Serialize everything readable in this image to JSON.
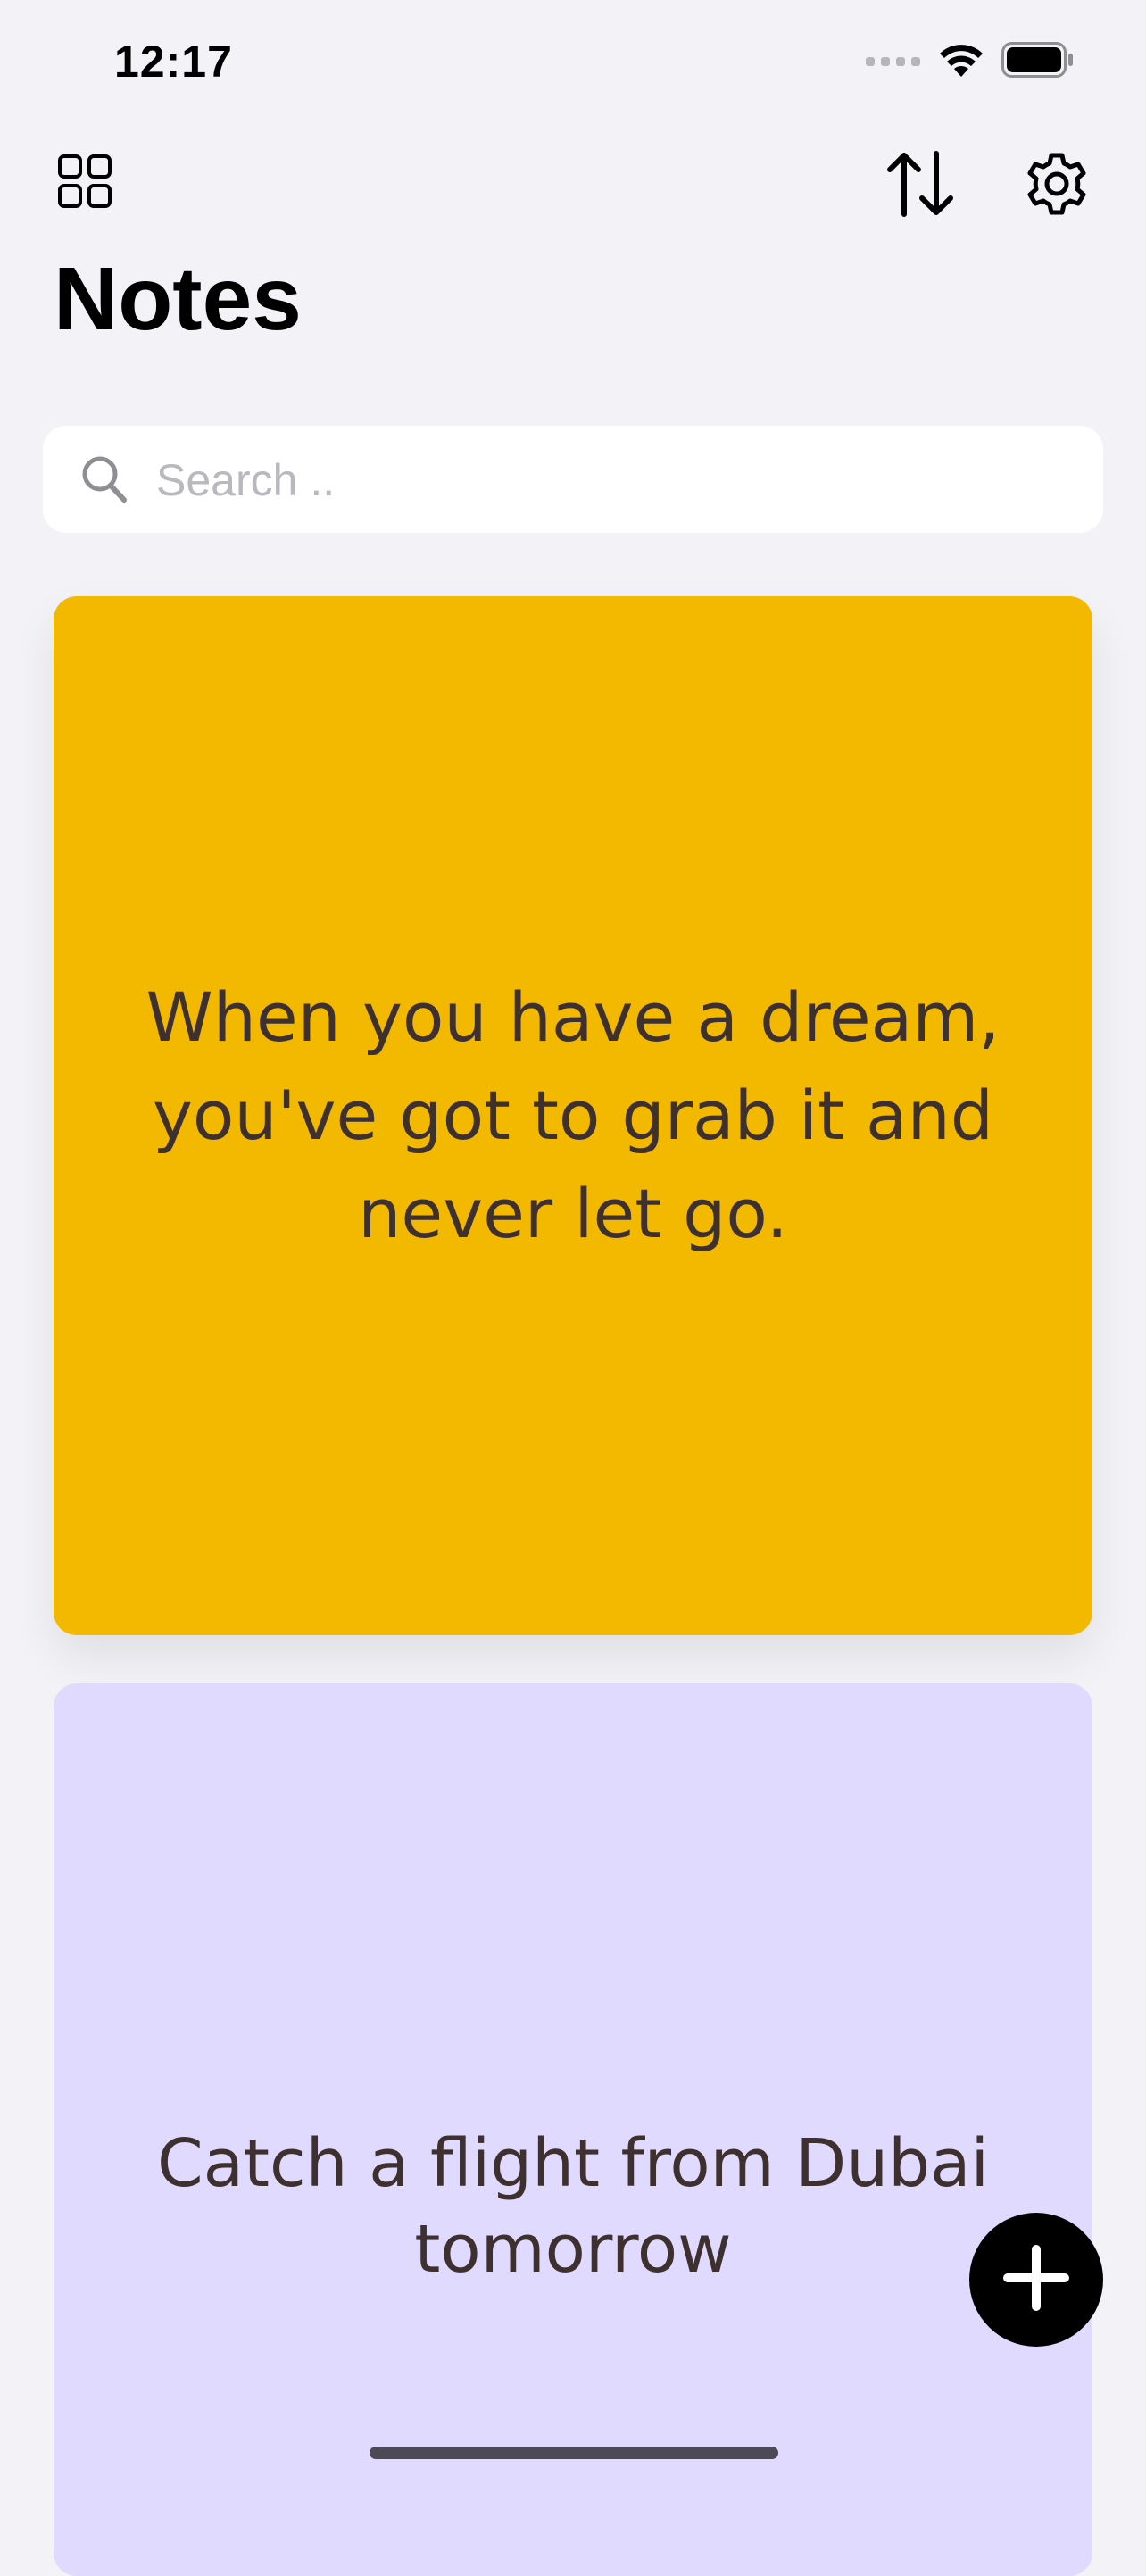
{
  "status_bar": {
    "time": "12:17",
    "icons": [
      "cellular-signal-icon",
      "wifi-icon",
      "battery-icon"
    ]
  },
  "toolbar": {
    "left_icon": "grid-view-icon",
    "right_icons": [
      "sort-icon",
      "settings-gear-icon"
    ]
  },
  "page_title": "Notes",
  "search": {
    "placeholder": "Search ..",
    "value": ""
  },
  "notes": [
    {
      "text": "When you have a dream, you've got to grab it and never let go.",
      "color": "#f2b900"
    },
    {
      "text": "Catch a flight from Dubai tomorrow",
      "color": "#e0daff"
    }
  ],
  "fab": {
    "icon": "plus-icon"
  },
  "colors": {
    "background": "#f2f2f7",
    "text_dark": "#3d302e",
    "accent": "#000000"
  }
}
